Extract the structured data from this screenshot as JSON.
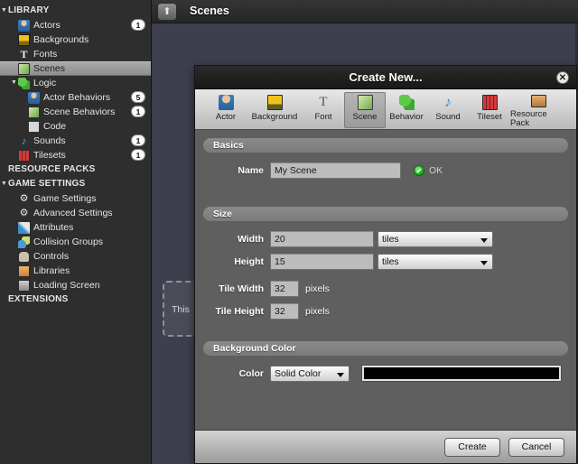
{
  "topbar": {
    "up_button_icon": "arrow-up-icon",
    "title": "Scenes"
  },
  "sidebar": {
    "sections": [
      {
        "label": "LIBRARY",
        "twisty": "▼",
        "items": [
          {
            "label": "Actors",
            "icon": "actor-icon",
            "badge": "1",
            "indent": 1
          },
          {
            "label": "Backgrounds",
            "icon": "background-icon",
            "badge": "",
            "indent": 1
          },
          {
            "label": "Fonts",
            "icon": "font-icon",
            "badge": "",
            "indent": 1
          },
          {
            "label": "Scenes",
            "icon": "scene-icon",
            "badge": "",
            "indent": 1,
            "selected": true
          },
          {
            "label": "Logic",
            "icon": "logic-icon",
            "badge": "",
            "indent": 1,
            "twisty": "▼"
          },
          {
            "label": "Actor Behaviors",
            "icon": "actor-icon",
            "badge": "5",
            "indent": 2
          },
          {
            "label": "Scene Behaviors",
            "icon": "scene-icon",
            "badge": "1",
            "indent": 2
          },
          {
            "label": "Code",
            "icon": "code-icon",
            "badge": "",
            "indent": 2
          },
          {
            "label": "Sounds",
            "icon": "sound-icon",
            "badge": "1",
            "indent": 1
          },
          {
            "label": "Tilesets",
            "icon": "tileset-icon",
            "badge": "1",
            "indent": 1
          }
        ]
      },
      {
        "label": "RESOURCE PACKS",
        "twisty": "",
        "items": []
      },
      {
        "label": "GAME SETTINGS",
        "twisty": "▼",
        "items": [
          {
            "label": "Game Settings",
            "icon": "gear-icon",
            "badge": "",
            "indent": 1
          },
          {
            "label": "Advanced Settings",
            "icon": "gear-icon",
            "badge": "",
            "indent": 1
          },
          {
            "label": "Attributes",
            "icon": "pencil-icon",
            "badge": "",
            "indent": 1
          },
          {
            "label": "Collision Groups",
            "icon": "collision-icon",
            "badge": "",
            "indent": 1
          },
          {
            "label": "Controls",
            "icon": "gamepad-icon",
            "badge": "",
            "indent": 1
          },
          {
            "label": "Libraries",
            "icon": "libraries-icon",
            "badge": "",
            "indent": 1
          },
          {
            "label": "Loading Screen",
            "icon": "loadingscreen-icon",
            "badge": "",
            "indent": 1
          }
        ]
      },
      {
        "label": "EXTENSIONS",
        "twisty": "",
        "items": []
      }
    ]
  },
  "content": {
    "placeholder_text": "This "
  },
  "dialog": {
    "title": "Create New...",
    "close_icon": "close-icon",
    "close_glyph": "✕",
    "toolbar": [
      {
        "label": "Actor",
        "icon": "actor-icon",
        "active": false
      },
      {
        "label": "Background",
        "icon": "background-icon",
        "active": false
      },
      {
        "label": "Font",
        "icon": "font-icon",
        "active": false
      },
      {
        "label": "Scene",
        "icon": "scene-icon",
        "active": true
      },
      {
        "label": "Behavior",
        "icon": "behavior-icon",
        "active": false
      },
      {
        "label": "Sound",
        "icon": "sound-icon",
        "active": false
      },
      {
        "label": "Tileset",
        "icon": "tileset-icon",
        "active": false
      },
      {
        "label": "Resource Pack",
        "icon": "resourcepack-icon",
        "active": false
      }
    ],
    "basics": {
      "section_label": "Basics",
      "name_label": "Name",
      "name_value": "My Scene",
      "name_placeholder": "",
      "status_icon": "check-circle-icon",
      "status_glyph": "✔",
      "status_text": "OK"
    },
    "size": {
      "section_label": "Size",
      "width_label": "Width",
      "width_value": "20",
      "width_unit": "tiles",
      "height_label": "Height",
      "height_value": "15",
      "height_unit": "tiles",
      "tile_width_label": "Tile Width",
      "tile_width_value": "32",
      "tile_width_unit": "pixels",
      "tile_height_label": "Tile Height",
      "tile_height_value": "32",
      "tile_height_unit": "pixels"
    },
    "background_color": {
      "section_label": "Background Color",
      "color_label": "Color",
      "mode_value": "Solid Color",
      "swatch_color": "#000000"
    },
    "footer": {
      "create_label": "Create",
      "cancel_label": "Cancel"
    }
  },
  "colors": {
    "sidebar_bg": "#2e2e2e",
    "content_bg": "#3d3f4d",
    "dialog_bg": "#5f5f5f",
    "accent_green": "#0fa80f"
  }
}
